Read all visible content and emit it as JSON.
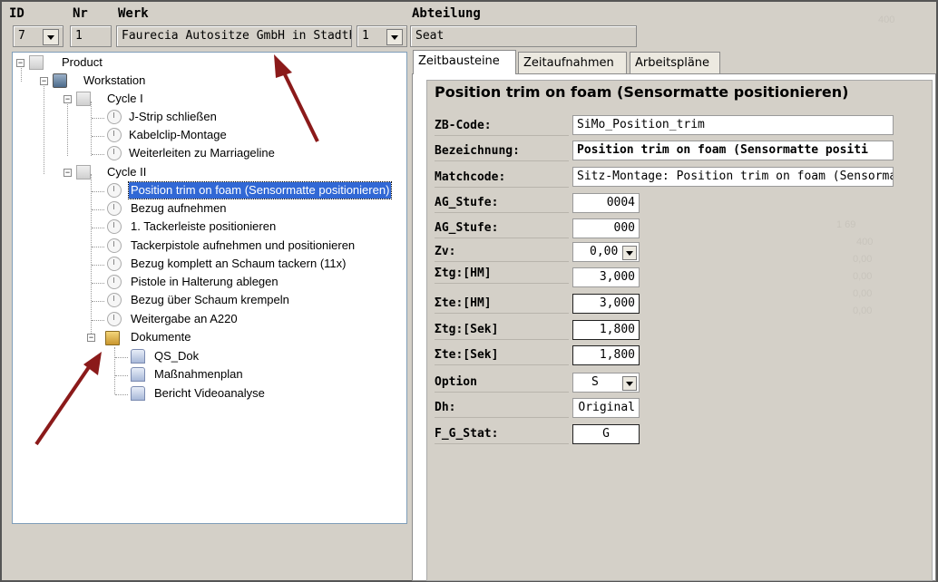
{
  "header": {
    "id_label": "ID",
    "nr_label": "Nr",
    "werk_label": "Werk",
    "abteilung_label": "Abteilung",
    "id_value": "7",
    "nr_value": "1",
    "werk_value": "Faurecia Autositze GmbH in Stadth",
    "abteilung_nr": "1",
    "abteilung_value": "Seat",
    "ghost_top": "400"
  },
  "tree": {
    "product": "Product",
    "workstation": "Workstation",
    "cycle1": "Cycle I",
    "cycle1_items": [
      "J-Strip schließen",
      "Kabelclip-Montage",
      "Weiterleiten zu Marriageline"
    ],
    "cycle2": "Cycle II",
    "cycle2_items": [
      "Position trim on foam (Sensormatte positionieren)",
      "Bezug aufnehmen",
      "1. Tackerleiste positionieren",
      "Tackerpistole aufnehmen und positionieren",
      "Bezug komplett an Schaum tackern (11x)",
      "Pistole in Halterung ablegen",
      "Bezug über Schaum krempeln",
      "Weitergabe an A220"
    ],
    "dokumente": "Dokumente",
    "dokumente_items": [
      "QS_Dok",
      "Maßnahmenplan",
      "Bericht Videoanalyse"
    ]
  },
  "tabs": [
    "Zeitbausteine",
    "Zeitaufnahmen",
    "Arbeitspläne"
  ],
  "form": {
    "title": "Position trim on foam (Sensormatte positionieren)",
    "fields": [
      {
        "label": "ZB-Code:",
        "value": "SiMo_Position_trim"
      },
      {
        "label": "Bezeichnung:",
        "value": "Position trim on foam (Sensormatte positi"
      },
      {
        "label": "Matchcode:",
        "value": "Sitz-Montage: Position trim on foam (Sensormat"
      },
      {
        "label": "AG_Stufe:",
        "value": "0004"
      },
      {
        "label": "AG_Stufe:",
        "value": "000"
      },
      {
        "label": "Zv:",
        "value": "0,00"
      },
      {
        "label": "Σtg:[HM]",
        "value": "3,000"
      },
      {
        "label": "Σte:[HM]",
        "value": "3,000"
      },
      {
        "label": "Σtg:[Sek]",
        "value": "1,800"
      },
      {
        "label": "Σte:[Sek]",
        "value": "1,800"
      },
      {
        "label": "Option",
        "value": "S"
      },
      {
        "label": "Dh:",
        "value": "Original"
      },
      {
        "label": "F_G_Stat:",
        "value": "G"
      }
    ],
    "ghost_values": [
      "1    69",
      "400",
      "0,00",
      "0,00",
      "0,00",
      "0,00"
    ]
  },
  "colors": {
    "arrow": "#8b1a1a",
    "selection": "#3168d5"
  }
}
